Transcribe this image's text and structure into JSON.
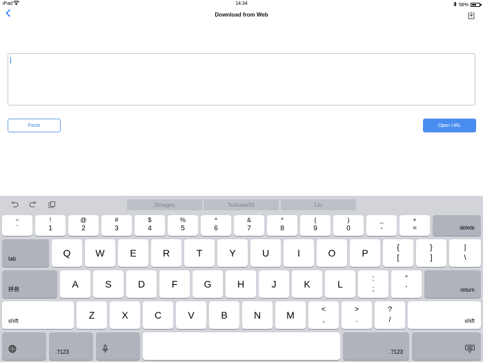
{
  "status_bar": {
    "device": "iPad",
    "time": "14:34",
    "battery_percent": "58%",
    "battery_level": 0.58
  },
  "nav": {
    "title": "Download from Web",
    "back_icon": "chevron-left-icon",
    "action_icon": "download-icon"
  },
  "url_input": {
    "value": "",
    "placeholder": ""
  },
  "buttons": {
    "paste": "Paste",
    "open_url": "Open URL"
  },
  "keyboard": {
    "suggestions": [
      "2images",
      "Testuser01",
      "Liu"
    ],
    "number_row": [
      {
        "top": "~",
        "bottom": "`"
      },
      {
        "top": "!",
        "bottom": "1"
      },
      {
        "top": "@",
        "bottom": "2"
      },
      {
        "top": "#",
        "bottom": "3"
      },
      {
        "top": "$",
        "bottom": "4"
      },
      {
        "top": "%",
        "bottom": "5"
      },
      {
        "top": "^",
        "bottom": "6"
      },
      {
        "top": "&",
        "bottom": "7"
      },
      {
        "top": "*",
        "bottom": "8"
      },
      {
        "top": "(",
        "bottom": "9"
      },
      {
        "top": ")",
        "bottom": "0"
      },
      {
        "top": "_",
        "bottom": "-"
      },
      {
        "top": "+",
        "bottom": "="
      }
    ],
    "delete": "delete",
    "tab": "tab",
    "row1": [
      "Q",
      "W",
      "E",
      "R",
      "T",
      "Y",
      "U",
      "I",
      "O",
      "P"
    ],
    "row1_symbols": [
      {
        "top": "{",
        "bottom": "["
      },
      {
        "top": "}",
        "bottom": "]"
      },
      {
        "top": "|",
        "bottom": "\\"
      }
    ],
    "pinyin": "拼音",
    "row2": [
      "A",
      "S",
      "D",
      "F",
      "G",
      "H",
      "J",
      "K",
      "L"
    ],
    "row2_symbols": [
      {
        "top": ":",
        "bottom": ";"
      },
      {
        "top": "”",
        "bottom": "’"
      }
    ],
    "return": "return",
    "shift": "shift",
    "row3": [
      "Z",
      "X",
      "C",
      "V",
      "B",
      "N",
      "M"
    ],
    "row3_symbols": [
      {
        "top": "<",
        "bottom": ","
      },
      {
        "top": ">",
        "bottom": "."
      },
      {
        "top": "?",
        "bottom": "/"
      }
    ],
    "numbers_label": ".?123"
  }
}
